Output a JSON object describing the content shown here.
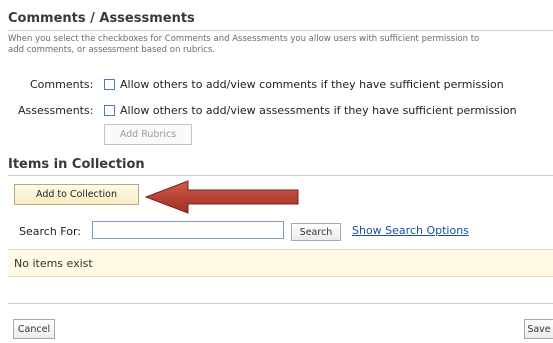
{
  "comments_section": {
    "title": "Comments / Assessments",
    "description_line1": "When you select the checkboxes for Comments and Assessments you allow users with sufficient permission to",
    "description_line2": "add comments, or assessment based on rubrics.",
    "comments_label": "Comments:",
    "comments_option": "Allow others to add/view comments if they have sufficient permission",
    "assessments_label": "Assessments:",
    "assessments_option": "Allow others to add/view assessments if they have sufficient permission",
    "add_rubrics_label": "Add Rubrics"
  },
  "items_section": {
    "title": "Items in Collection",
    "add_button_label": "Add to Collection",
    "search_label": "Search For:",
    "search_value": "",
    "search_button_label": "Search",
    "show_options_link": "Show Search Options",
    "empty_message": "No items exist"
  },
  "footer": {
    "cancel_label": "Cancel",
    "save_label": "Save"
  },
  "colors": {
    "arrow": "#b83a2e",
    "notice_bg": "#fffbe5"
  }
}
